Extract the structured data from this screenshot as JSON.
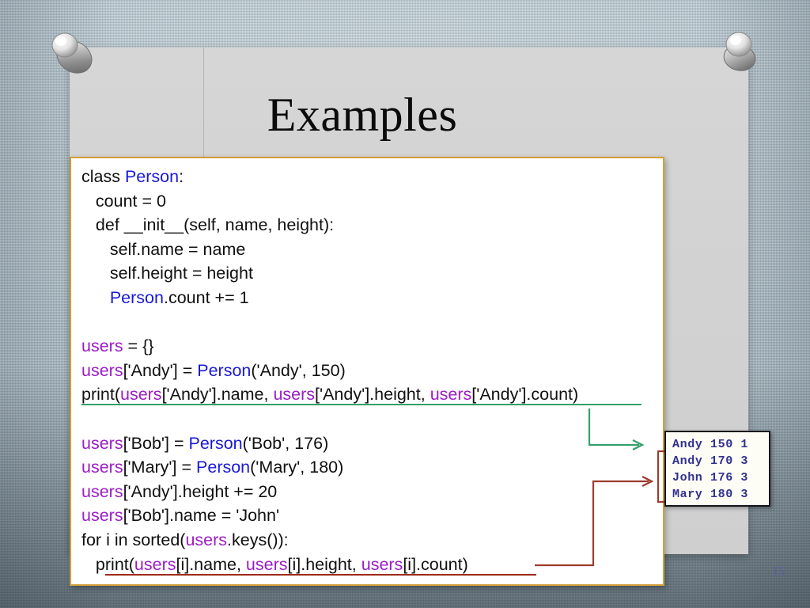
{
  "slide": {
    "title": "Examples",
    "page_number": "15"
  },
  "code": {
    "lines": [
      [
        {
          "t": "class ",
          "c": "plain"
        },
        {
          "t": "Person",
          "c": "class"
        },
        {
          "t": ":",
          "c": "plain"
        }
      ],
      [
        {
          "t": "   count = 0",
          "c": "plain"
        }
      ],
      [
        {
          "t": "   def __init__(self, name, height):",
          "c": "plain"
        }
      ],
      [
        {
          "t": "      self.name = name",
          "c": "plain"
        }
      ],
      [
        {
          "t": "      self.height = height",
          "c": "plain"
        }
      ],
      [
        {
          "t": "      ",
          "c": "plain"
        },
        {
          "t": "Person",
          "c": "class"
        },
        {
          "t": ".count += 1",
          "c": "plain"
        }
      ],
      [],
      [
        {
          "t": "users",
          "c": "var"
        },
        {
          "t": " = {}",
          "c": "plain"
        }
      ],
      [
        {
          "t": "users",
          "c": "var"
        },
        {
          "t": "['Andy'] = ",
          "c": "plain"
        },
        {
          "t": "Person",
          "c": "class"
        },
        {
          "t": "('Andy', 150)",
          "c": "plain"
        }
      ],
      [
        {
          "t": "print(",
          "c": "plain"
        },
        {
          "t": "users",
          "c": "var"
        },
        {
          "t": "['Andy'].name, ",
          "c": "plain"
        },
        {
          "t": "users",
          "c": "var"
        },
        {
          "t": "['Andy'].height, ",
          "c": "plain"
        },
        {
          "t": "users",
          "c": "var"
        },
        {
          "t": "['Andy'].count)",
          "c": "plain"
        }
      ],
      [],
      [
        {
          "t": "users",
          "c": "var"
        },
        {
          "t": "['Bob'] = ",
          "c": "plain"
        },
        {
          "t": "Person",
          "c": "class"
        },
        {
          "t": "('Bob', 176)",
          "c": "plain"
        }
      ],
      [
        {
          "t": "users",
          "c": "var"
        },
        {
          "t": "['Mary'] = ",
          "c": "plain"
        },
        {
          "t": "Person",
          "c": "class"
        },
        {
          "t": "('Mary', 180)",
          "c": "plain"
        }
      ],
      [
        {
          "t": "users",
          "c": "var"
        },
        {
          "t": "['Andy'].height += 20",
          "c": "plain"
        }
      ],
      [
        {
          "t": "users",
          "c": "var"
        },
        {
          "t": "['Bob'].name = 'John'",
          "c": "plain"
        }
      ],
      [
        {
          "t": "for i in sorted(",
          "c": "plain"
        },
        {
          "t": "users",
          "c": "var"
        },
        {
          "t": ".keys()):",
          "c": "plain"
        }
      ],
      [
        {
          "t": "   print(",
          "c": "plain"
        },
        {
          "t": "users",
          "c": "var"
        },
        {
          "t": "[i].name, ",
          "c": "plain"
        },
        {
          "t": "users",
          "c": "var"
        },
        {
          "t": "[i].height, ",
          "c": "plain"
        },
        {
          "t": "users",
          "c": "var"
        },
        {
          "t": "[i].count)",
          "c": "plain"
        }
      ]
    ],
    "colors": {
      "class_name": "#1a19d8",
      "variable": "#9b1ec4",
      "plain": "#101010",
      "panel_border": "#d3a03a",
      "underline_green": "#34a06a",
      "underline_red": "#9e2b18"
    }
  },
  "output": {
    "rows": [
      "Andy 150 1",
      "Andy 170 3",
      "John 176 3",
      "Mary 180 3"
    ],
    "text_color": "#31318f",
    "background": "#fdfdf6"
  },
  "annotations": {
    "green_arrow": "print-to-first-output-row",
    "red_arrow": "loop-print-to-remaining-output-rows"
  },
  "theme": {
    "background": "#a9bdc7",
    "slide_background": "#d3d3d3"
  }
}
